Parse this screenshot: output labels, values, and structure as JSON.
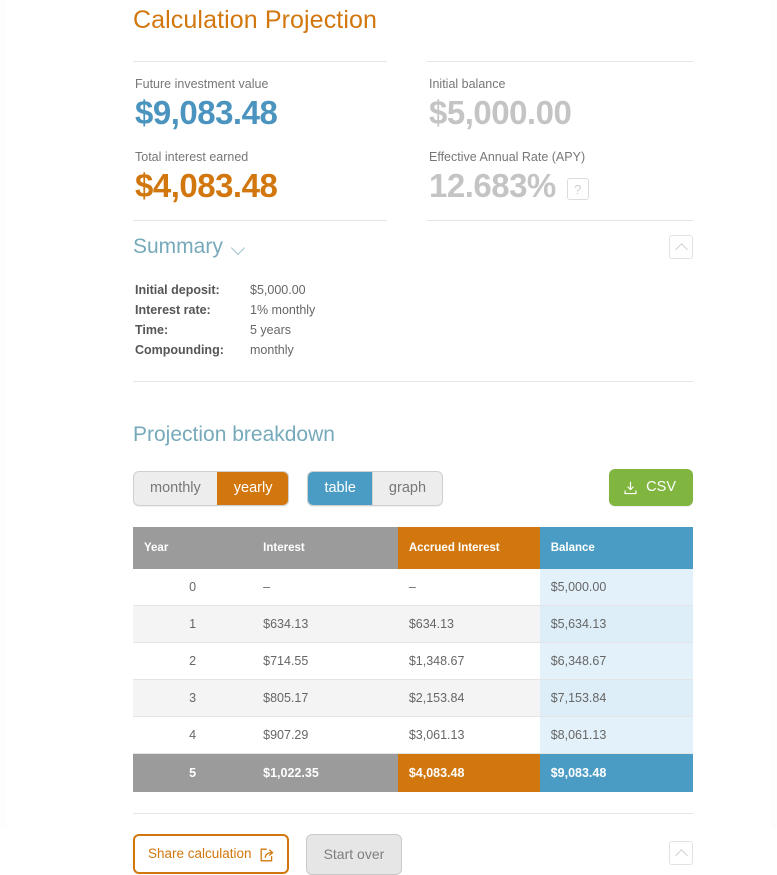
{
  "title": "Calculation Projection",
  "results": {
    "left": [
      {
        "label": "Future investment value",
        "value": "$9,083.48",
        "color": "#4a94bf"
      },
      {
        "label": "Total interest earned",
        "value": "$4,083.48",
        "color": "#d2770d"
      }
    ],
    "right": [
      {
        "label": "Initial balance",
        "value": "$5,000.00",
        "color": "#c4c4c4"
      },
      {
        "label": "Effective Annual Rate (APY)",
        "value": "12.683%",
        "color": "#c4c4c4",
        "help": "?"
      }
    ]
  },
  "summary": {
    "heading": "Summary",
    "rows": [
      {
        "key": "Initial deposit:",
        "value": "$5,000.00"
      },
      {
        "key": "Interest rate:",
        "value": "1% monthly"
      },
      {
        "key": "Time:",
        "value": "5 years"
      },
      {
        "key": "Compounding:",
        "value": "monthly"
      }
    ]
  },
  "breakdown": {
    "heading": "Projection breakdown",
    "period_toggle": {
      "options": [
        "monthly",
        "yearly"
      ],
      "selected": "yearly"
    },
    "view_toggle": {
      "options": [
        "table",
        "graph"
      ],
      "selected": "table"
    },
    "csv_label": "CSV",
    "columns": [
      "Year",
      "Interest",
      "Accrued Interest",
      "Balance"
    ],
    "rows": [
      {
        "year": "0",
        "interest": "–",
        "accrued": "–",
        "balance": "$5,000.00"
      },
      {
        "year": "1",
        "interest": "$634.13",
        "accrued": "$634.13",
        "balance": "$5,634.13"
      },
      {
        "year": "2",
        "interest": "$714.55",
        "accrued": "$1,348.67",
        "balance": "$6,348.67"
      },
      {
        "year": "3",
        "interest": "$805.17",
        "accrued": "$2,153.84",
        "balance": "$7,153.84"
      },
      {
        "year": "4",
        "interest": "$907.29",
        "accrued": "$3,061.13",
        "balance": "$8,061.13"
      },
      {
        "year": "5",
        "interest": "$1,022.35",
        "accrued": "$4,083.48",
        "balance": "$9,083.48",
        "total": true
      }
    ]
  },
  "footer": {
    "share_label": "Share calculation",
    "start_over_label": "Start over"
  },
  "colors": {
    "orange": "#d2770d",
    "blue": "#4a9cc4",
    "teal": "#76aabb",
    "green": "#80b53f",
    "grey": "#9b9b9b"
  }
}
